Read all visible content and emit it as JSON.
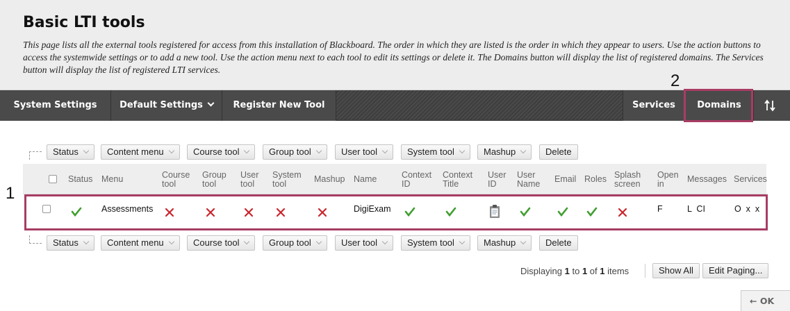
{
  "header": {
    "title": "Basic LTI tools",
    "description": "This page lists all the external tools registered for access from this installation of Blackboard. The order in which they are listed is the order in which they appear to users. Use the action buttons to access the systemwide settings or to add a new tool. Use the action menu next to each tool to edit its settings or delete it. The Domains button will display the list of registered domains. The Services button will display the list of registered LTI services."
  },
  "actionbar": {
    "system_settings": "System Settings",
    "default_settings": "Default Settings",
    "register_new_tool": "Register New Tool",
    "services": "Services",
    "domains": "Domains"
  },
  "annotations": {
    "label_1": "1",
    "label_2": "2"
  },
  "filterbar": {
    "status": "Status",
    "content_menu": "Content menu",
    "course_tool": "Course tool",
    "group_tool": "Group tool",
    "user_tool": "User tool",
    "system_tool": "System tool",
    "mashup": "Mashup",
    "delete": "Delete"
  },
  "table": {
    "headers": {
      "status": "Status",
      "menu": "Menu",
      "course_tool_1": "Course",
      "course_tool_2": "tool",
      "group_tool_1": "Group",
      "group_tool_2": "tool",
      "user_tool_1": "User",
      "user_tool_2": "tool",
      "system_tool_1": "System",
      "system_tool_2": "tool",
      "mashup": "Mashup",
      "name": "Name",
      "context_id_1": "Context",
      "context_id_2": "ID",
      "context_title_1": "Context",
      "context_title_2": "Title",
      "user_id_1": "User",
      "user_id_2": "ID",
      "user_name_1": "User",
      "user_name_2": "Name",
      "email": "Email",
      "roles": "Roles",
      "splash_1": "Splash",
      "splash_2": "screen",
      "open_in_1": "Open",
      "open_in_2": "in",
      "messages": "Messages",
      "services": "Services"
    },
    "row": {
      "menu": "Assessments",
      "name": "DigiExam",
      "open_in": "F",
      "messages": "L  CI",
      "services": "O  x  x"
    }
  },
  "footer": {
    "displaying": "Displaying",
    "from": "1",
    "to_word": "to",
    "to": "1",
    "of_word": "of",
    "total": "1",
    "items_word": "items",
    "show_all": "Show All",
    "edit_paging": "Edit Paging...",
    "ok": "OK"
  },
  "colors": {
    "check": "#3f9e2f",
    "cross": "#c9252c",
    "highlight": "#a83c64"
  }
}
